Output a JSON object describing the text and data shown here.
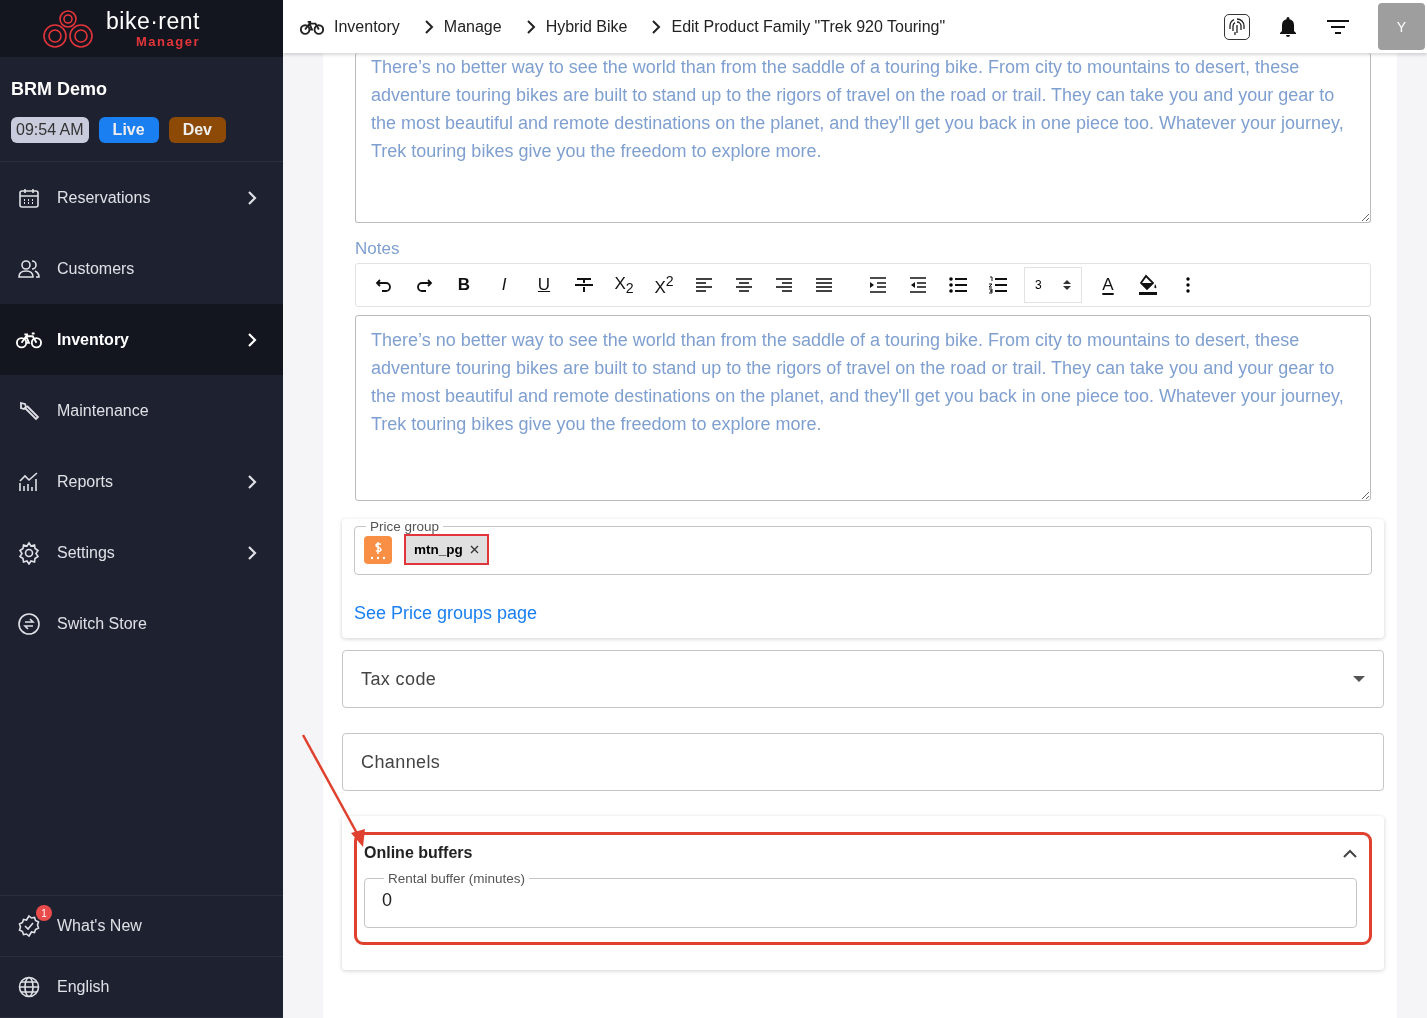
{
  "brand": {
    "name": "bike·rent",
    "sub": "Manager"
  },
  "store": {
    "name": "BRM Demo",
    "time": "09:54 AM",
    "badges": [
      {
        "text": "Live",
        "color": "#1a7ff0"
      },
      {
        "text": "Dev",
        "color": "#8c4a06"
      }
    ]
  },
  "sidebar": {
    "items": [
      {
        "kind": "calendar",
        "label": "Reservations",
        "chevron": true,
        "selected": false
      },
      {
        "kind": "people",
        "label": "Customers",
        "chevron": false,
        "selected": false
      },
      {
        "kind": "bike",
        "label": "Inventory",
        "chevron": true,
        "selected": true
      },
      {
        "kind": "wrench",
        "label": "Maintenance",
        "chevron": false,
        "selected": false
      },
      {
        "kind": "chart",
        "label": "Reports",
        "chevron": true,
        "selected": false
      },
      {
        "kind": "gear",
        "label": "Settings",
        "chevron": true,
        "selected": false
      },
      {
        "kind": "swap",
        "label": "Switch Store",
        "chevron": false,
        "selected": false
      }
    ],
    "footer": [
      {
        "kind": "badge",
        "label": "What's New",
        "count": "1"
      },
      {
        "kind": "globe",
        "label": "English"
      }
    ]
  },
  "breadcrumbs": [
    "Inventory",
    "Manage",
    "Hybrid Bike",
    "Edit Product Family \"Trek 920 Touring\""
  ],
  "avatar": "Y",
  "description": {
    "placeholder": "There’s no better way to see the world than from the saddle of a touring bike. From city to mountains to desert, these adventure touring bikes are built to stand up to the rigors of travel on the road or trail. They can take you and your gear to the most beautiful and remote destinations on the planet, and they'll get you back in one piece too. Whatever your journey, Trek touring bikes give you the freedom to explore more."
  },
  "notes": {
    "label": "Notes",
    "placeholder": "There’s no better way to see the world than from the saddle of a touring bike. From city to mountains to desert, these adventure touring bikes are built to stand up to the rigors of travel on the road or trail. They can take you and your gear to the most beautiful and remote destinations on the planet, and they'll get you back in one piece too. Whatever your journey, Trek touring bikes give you the freedom to explore more.",
    "toolbar": [
      {
        "kind": "undo"
      },
      {
        "kind": "redo"
      },
      {
        "kind": "bold",
        "text": "B"
      },
      {
        "kind": "italic",
        "text": "I"
      },
      {
        "kind": "underline",
        "text": "U"
      },
      {
        "kind": "strike"
      },
      {
        "kind": "script",
        "text": "X$_{2}$"
      },
      {
        "kind": "script",
        "text": "X$^{2}$"
      },
      {
        "kind": "left"
      },
      {
        "kind": "center"
      },
      {
        "kind": "right"
      },
      {
        "kind": "justify"
      },
      {
        "kind": "indent"
      },
      {
        "kind": "outdent"
      },
      {
        "kind": "bullets"
      },
      {
        "kind": "numbers"
      },
      {
        "kind": "size",
        "value": "3"
      },
      {
        "kind": "color",
        "text": "A"
      },
      {
        "kind": "fill"
      },
      {
        "kind": "more"
      }
    ]
  },
  "price_group": {
    "label": "Price group",
    "chips": [
      {
        "text": "mtn_pg",
        "highlighted": true
      }
    ],
    "link": "See Price groups page"
  },
  "tax_code": {
    "label": "Tax code"
  },
  "channels": {
    "label": "Channels"
  },
  "online_buffers": {
    "title": "Online buffers",
    "expanded": true,
    "highlighted": true,
    "field_label": "Rental buffer (minutes)",
    "value": "0"
  },
  "annotation_arrow": true
}
